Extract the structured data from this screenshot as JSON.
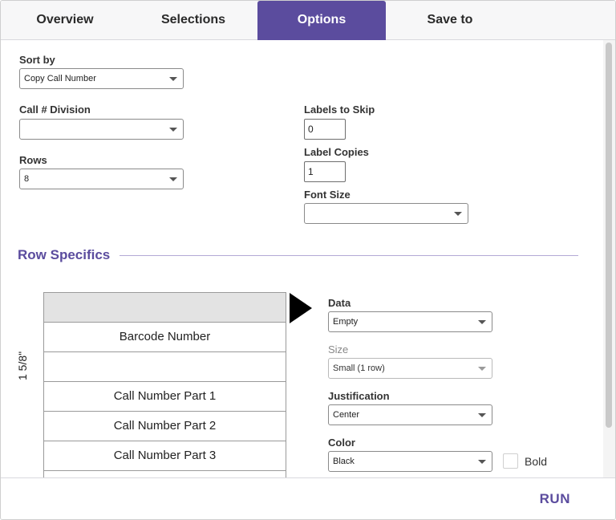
{
  "tabs": [
    {
      "label": "Overview"
    },
    {
      "label": "Selections"
    },
    {
      "label": "Options",
      "active": true
    },
    {
      "label": "Save to"
    }
  ],
  "colors": {
    "accent": "#5b4c9e",
    "selected_row": "#e3e3e3"
  },
  "options": {
    "sort_by": {
      "label": "Sort by",
      "value": "Copy Call Number"
    },
    "call_division": {
      "label": "Call # Division",
      "value": ""
    },
    "rows": {
      "label": "Rows",
      "value": "8"
    },
    "labels_to_skip": {
      "label": "Labels to Skip",
      "value": "0"
    },
    "label_copies": {
      "label": "Label Copies",
      "value": "1"
    },
    "font_size": {
      "label": "Font Size",
      "value": ""
    }
  },
  "row_specifics": {
    "title": "Row Specifics",
    "dimension": "1 5/8\"",
    "rows": [
      "",
      "Barcode Number",
      "",
      "Call Number Part 1",
      "Call Number Part 2",
      "Call Number Part 3",
      ""
    ],
    "selected_index": 0,
    "data": {
      "label": "Data",
      "value": "Empty"
    },
    "size": {
      "label": "Size",
      "value": "Small (1 row)",
      "disabled": true
    },
    "justification": {
      "label": "Justification",
      "value": "Center"
    },
    "color": {
      "label": "Color",
      "value": "Black"
    },
    "bold": {
      "label": "Bold",
      "checked": false
    }
  },
  "footer": {
    "run_label": "RUN"
  }
}
